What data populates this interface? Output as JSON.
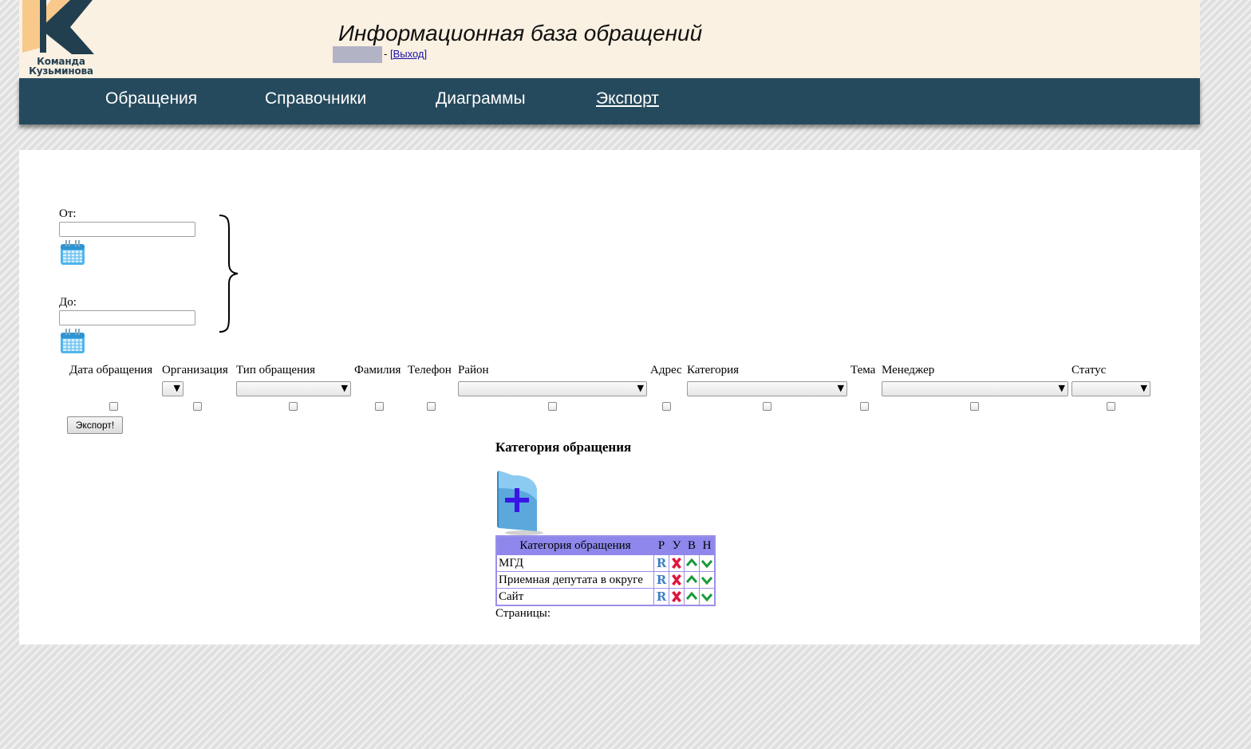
{
  "header": {
    "logo_text_line1": "Команда",
    "logo_text_line2": "Кузьминова",
    "title": "Информационная база обращений",
    "separator": "-",
    "logout_label": "[Выход]"
  },
  "nav": {
    "items": [
      {
        "label": "Обращения",
        "active": false
      },
      {
        "label": "Справочники",
        "active": false
      },
      {
        "label": "Диаграммы",
        "active": false
      },
      {
        "label": "Экспорт",
        "active": true
      }
    ]
  },
  "date_range": {
    "from_label": "От:",
    "from_value": "",
    "to_label": "До:",
    "to_value": "",
    "calendar_icon": "calendar-icon"
  },
  "export_fields": {
    "columns": [
      "Дата обращения",
      "Организация",
      "Тип обращения",
      "Фамилия",
      "Телефон",
      "Район",
      "Адрес",
      "Категория",
      "Тема",
      "Менеджер",
      "Статус"
    ],
    "selects": {
      "organization": "",
      "request_type": "",
      "district": "",
      "category": "",
      "manager": "",
      "status": ""
    },
    "checkboxes_checked": [
      false,
      false,
      false,
      false,
      false,
      false,
      false,
      false,
      false,
      false,
      false
    ],
    "export_button_label": "Экспорт!"
  },
  "category_section": {
    "title": "Категория обращения",
    "add_icon": "add-folder-icon",
    "table": {
      "headers": [
        "Категория обращения",
        "Р",
        "У",
        "В",
        "Н"
      ],
      "rows": [
        {
          "name": "МГД"
        },
        {
          "name": "Приемная депутата в округе"
        },
        {
          "name": "Сайт"
        }
      ],
      "action_icons": [
        "edit-r-icon",
        "delete-x-icon",
        "move-up-icon",
        "move-down-icon"
      ],
      "edit_glyph": "R"
    },
    "pages_label": "Страницы:"
  },
  "colors": {
    "header_bg": "#faf1e2",
    "nav_bg": "#264a5d",
    "table_header_bg": "#8f87eb",
    "table_border": "#9c8fe8",
    "delete_red": "#e0143c",
    "arrow_green": "#1a9a3a",
    "logo_navy": "#223f50",
    "logo_peach": "#f8c98a"
  }
}
